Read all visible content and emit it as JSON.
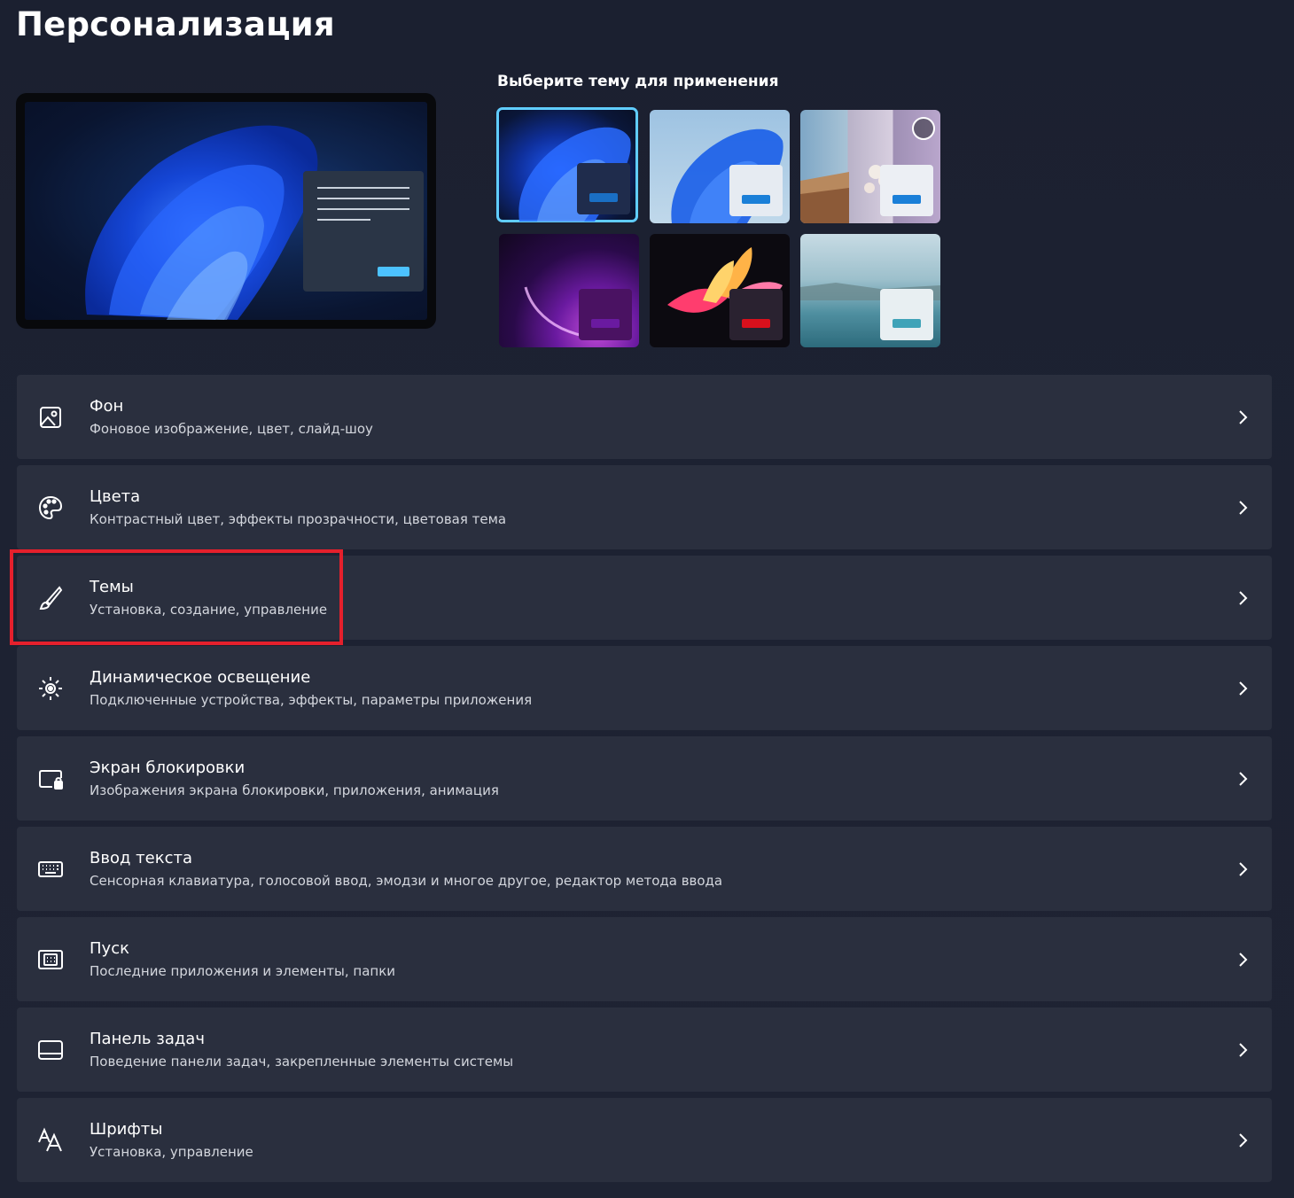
{
  "page": {
    "title": "Персонализация"
  },
  "themes": {
    "label": "Выберите тему для применения",
    "items": [
      {
        "name": "windows-dark-bloom",
        "accent": "#1a6fc4",
        "selected": true
      },
      {
        "name": "windows-light-bloom",
        "accent": "#1a7fd8",
        "selected": false
      },
      {
        "name": "windows-spotlight",
        "accent": "#1a7fd8",
        "selected": false
      },
      {
        "name": "glow",
        "accent": "#6a1aa0",
        "selected": false
      },
      {
        "name": "captured-motion",
        "accent": "#d8101c",
        "selected": false
      },
      {
        "name": "flow",
        "accent": "#3fa3b8",
        "selected": false
      }
    ]
  },
  "settings": [
    {
      "icon": "background-image-icon",
      "title": "Фон",
      "subtitle": "Фоновое изображение, цвет, слайд-шоу"
    },
    {
      "icon": "palette-icon",
      "title": "Цвета",
      "subtitle": "Контрастный цвет, эффекты прозрачности, цветовая тема"
    },
    {
      "icon": "brush-icon",
      "title": "Темы",
      "subtitle": "Установка, создание, управление"
    },
    {
      "icon": "dynamic-lighting-icon",
      "title": "Динамическое освещение",
      "subtitle": "Подключенные устройства, эффекты, параметры приложения"
    },
    {
      "icon": "lock-screen-icon",
      "title": "Экран блокировки",
      "subtitle": "Изображения экрана блокировки, приложения, анимация"
    },
    {
      "icon": "keyboard-icon",
      "title": "Ввод текста",
      "subtitle": "Сенсорная клавиатура, голосовой ввод, эмодзи и многое другое, редактор метода ввода"
    },
    {
      "icon": "start-icon",
      "title": "Пуск",
      "subtitle": "Последние приложения и элементы, папки"
    },
    {
      "icon": "taskbar-icon",
      "title": "Панель задач",
      "subtitle": "Поведение панели задач, закрепленные элементы системы"
    },
    {
      "icon": "fonts-icon",
      "title": "Шрифты",
      "subtitle": "Установка, управление"
    }
  ],
  "colors": {
    "selection_outline": "#60cdff",
    "highlight_box": "#e5202c",
    "row_background": "#2a2f3e"
  }
}
